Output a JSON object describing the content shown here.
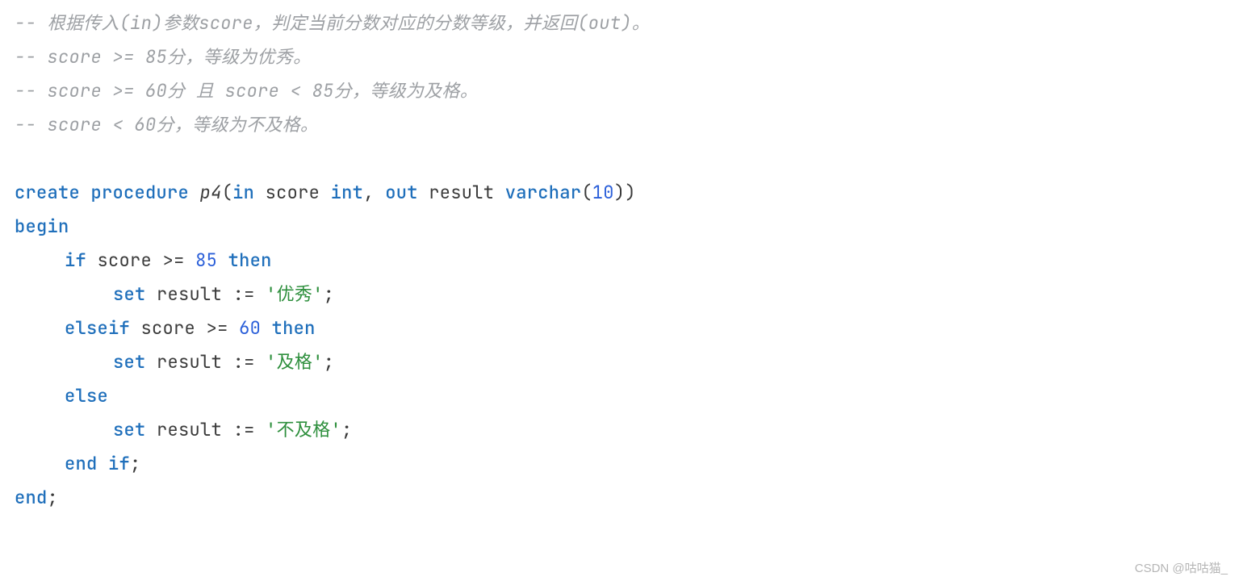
{
  "lines": {
    "c1": "-- 根据传入(in)参数score，判定当前分数对应的分数等级，并返回(out)。",
    "c2": "-- score >= 85分，等级为优秀。",
    "c3": "-- score >= 60分 且 score < 85分，等级为及格。",
    "c4": "-- score < 60分，等级为不及格。"
  },
  "tokens": {
    "create": "create",
    "procedure": "procedure",
    "p4": "p4",
    "lparen": "(",
    "in": "in",
    "score": "score",
    "int": "int",
    "comma": ",",
    "out": "out",
    "result": "result",
    "varchar": "varchar",
    "ten": "10",
    "rparen": ")",
    "begin": "begin",
    "if": "if",
    "gte": ">=",
    "eighty_five": "85",
    "then": "then",
    "set": "set",
    "assign": ":=",
    "str_excellent": "'优秀'",
    "semicolon": ";",
    "elseif": "elseif",
    "sixty": "60",
    "str_pass": "'及格'",
    "else": "else",
    "str_fail": "'不及格'",
    "end": "end",
    "ifw": "if"
  },
  "watermark": "CSDN @咕咕猫_"
}
